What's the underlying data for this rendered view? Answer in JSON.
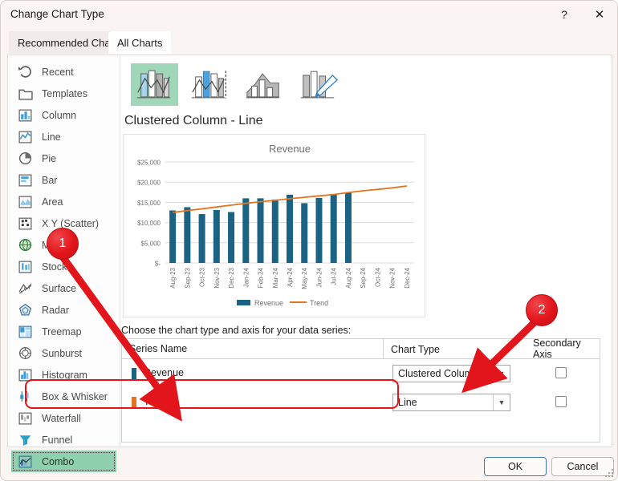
{
  "window": {
    "title": "Change Chart Type",
    "help_label": "?",
    "close_label": "✕"
  },
  "tabs": [
    {
      "label": "Recommended Charts",
      "selected": false
    },
    {
      "label": "All Charts",
      "selected": true
    }
  ],
  "categories": [
    {
      "label": "Recent",
      "icon": "recent-icon",
      "selected": false
    },
    {
      "label": "Templates",
      "icon": "templates-icon",
      "selected": false
    },
    {
      "label": "Column",
      "icon": "column-icon",
      "selected": false
    },
    {
      "label": "Line",
      "icon": "line-icon",
      "selected": false
    },
    {
      "label": "Pie",
      "icon": "pie-icon",
      "selected": false
    },
    {
      "label": "Bar",
      "icon": "bar-icon",
      "selected": false
    },
    {
      "label": "Area",
      "icon": "area-icon",
      "selected": false
    },
    {
      "label": "X Y (Scatter)",
      "icon": "scatter-icon",
      "selected": false
    },
    {
      "label": "Map",
      "icon": "map-icon",
      "selected": false
    },
    {
      "label": "Stock",
      "icon": "stock-icon",
      "selected": false
    },
    {
      "label": "Surface",
      "icon": "surface-icon",
      "selected": false
    },
    {
      "label": "Radar",
      "icon": "radar-icon",
      "selected": false
    },
    {
      "label": "Treemap",
      "icon": "treemap-icon",
      "selected": false
    },
    {
      "label": "Sunburst",
      "icon": "sunburst-icon",
      "selected": false
    },
    {
      "label": "Histogram",
      "icon": "histogram-icon",
      "selected": false
    },
    {
      "label": "Box & Whisker",
      "icon": "boxwhisker-icon",
      "selected": false
    },
    {
      "label": "Waterfall",
      "icon": "waterfall-icon",
      "selected": false
    },
    {
      "label": "Funnel",
      "icon": "funnel-icon",
      "selected": false
    },
    {
      "label": "Combo",
      "icon": "combo-icon",
      "selected": true
    }
  ],
  "thumbnails": [
    {
      "name": "clustered-column-line",
      "selected": true
    },
    {
      "name": "clustered-column-line-secondary",
      "selected": false
    },
    {
      "name": "stacked-area-clustered-column",
      "selected": false
    },
    {
      "name": "custom-combination",
      "selected": false
    }
  ],
  "chart_type_name": "Clustered Column - Line",
  "series_chooser": {
    "label": "Choose the chart type and axis for your data series:",
    "columns": [
      "Series Name",
      "Chart Type",
      "Secondary Axis"
    ],
    "rows": [
      {
        "name": "Revenue",
        "swatch_color": "#1b6383",
        "chart_type": "Clustered Column",
        "secondary_axis": false,
        "highlighted": false
      },
      {
        "name": "Trend",
        "swatch_color": "#e2751f",
        "chart_type": "Line",
        "secondary_axis": false,
        "highlighted": true
      }
    ]
  },
  "footer": {
    "ok_label": "OK",
    "cancel_label": "Cancel"
  },
  "annotations": [
    {
      "id": "1",
      "label": "1",
      "color": "#e2151c"
    },
    {
      "id": "2",
      "label": "2",
      "color": "#e2151c"
    }
  ],
  "chart_data": {
    "type": "bar",
    "title": "Revenue",
    "xlabel": "",
    "ylabel": "",
    "ylim": [
      0,
      25000
    ],
    "yticks": [
      0,
      5000,
      10000,
      15000,
      20000,
      25000
    ],
    "ytick_labels": [
      "$-",
      "$5,000",
      "$10,000",
      "$15,000",
      "$20,000",
      "$25,000"
    ],
    "grid": true,
    "legend_position": "bottom",
    "categories": [
      "Aug-23",
      "Sep-23",
      "Oct-23",
      "Nov-23",
      "Dec-23",
      "Jan-24",
      "Feb-24",
      "Mar-24",
      "Apr-24",
      "May-24",
      "Jun-24",
      "Jul-24",
      "Aug-24",
      "Sep-24",
      "Oct-24",
      "Nov-24",
      "Dec-24"
    ],
    "series": [
      {
        "name": "Revenue",
        "kind": "bar",
        "color": "#1b6383",
        "values": [
          13000,
          13800,
          12100,
          13100,
          12600,
          16000,
          16000,
          15700,
          16900,
          14800,
          16100,
          17000,
          17400,
          null,
          null,
          null,
          null
        ]
      },
      {
        "name": "Trend",
        "kind": "line",
        "color": "#e2751f",
        "values": [
          12500,
          12950,
          13400,
          13850,
          14300,
          14750,
          15150,
          15500,
          15900,
          16250,
          16600,
          16950,
          17450,
          17850,
          18200,
          18600,
          19050
        ]
      }
    ]
  }
}
